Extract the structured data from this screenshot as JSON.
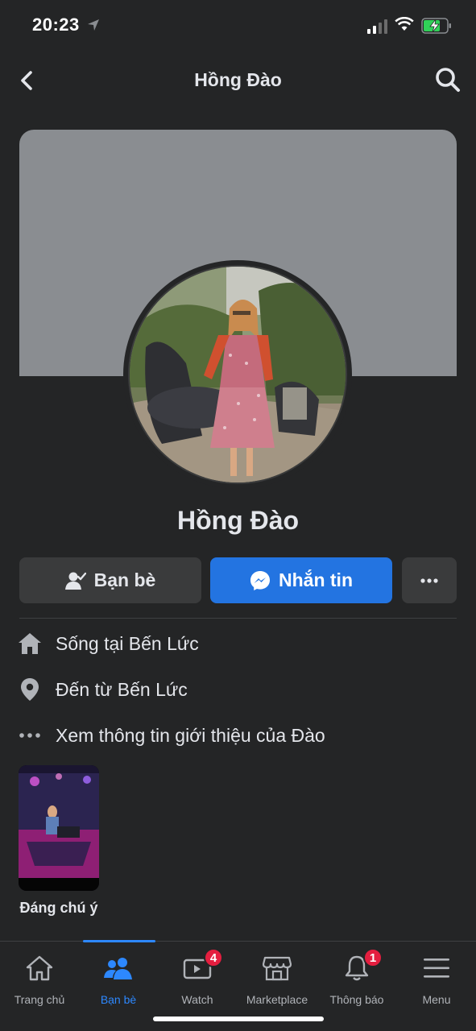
{
  "status_bar": {
    "time": "20:23"
  },
  "header": {
    "title": "Hồng Đào"
  },
  "profile": {
    "name": "Hồng Đào"
  },
  "actions": {
    "friends_label": "Bạn bè",
    "message_label": "Nhắn tin"
  },
  "intro": [
    {
      "text": "Sống tại ",
      "bold": "Bến Lức",
      "icon": "home-icon"
    },
    {
      "text": "Đến từ ",
      "bold": "Bến Lức",
      "icon": "location-pin-icon"
    },
    {
      "text": "Xem thông tin giới thiệu của Đào",
      "bold": "",
      "icon": "more-dots-icon"
    }
  ],
  "featured": {
    "label": "Đáng chú ý"
  },
  "bottom_nav": [
    {
      "label": "Trang chủ",
      "icon": "home-icon"
    },
    {
      "label": "Bạn bè",
      "icon": "friends-icon",
      "active": true
    },
    {
      "label": "Watch",
      "icon": "watch-icon",
      "badge": "4"
    },
    {
      "label": "Marketplace",
      "icon": "marketplace-icon"
    },
    {
      "label": "Thông báo",
      "icon": "bell-icon",
      "badge": "1"
    },
    {
      "label": "Menu",
      "icon": "menu-icon"
    }
  ],
  "colors": {
    "accent": "#2374e1",
    "background": "#242526",
    "badge": "#e41e3f"
  }
}
